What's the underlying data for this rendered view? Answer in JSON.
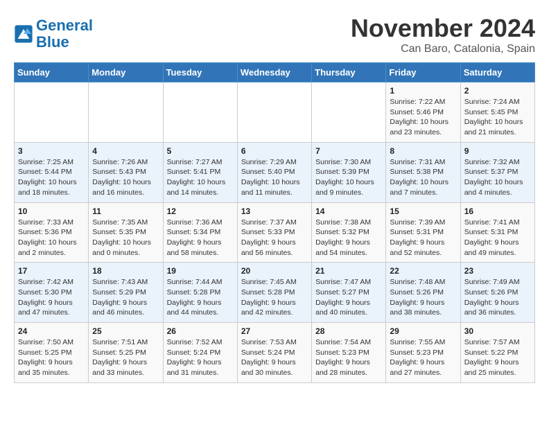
{
  "logo": {
    "line1": "General",
    "line2": "Blue"
  },
  "title": "November 2024",
  "location": "Can Baro, Catalonia, Spain",
  "weekdays": [
    "Sunday",
    "Monday",
    "Tuesday",
    "Wednesday",
    "Thursday",
    "Friday",
    "Saturday"
  ],
  "weeks": [
    [
      {
        "day": "",
        "info": ""
      },
      {
        "day": "",
        "info": ""
      },
      {
        "day": "",
        "info": ""
      },
      {
        "day": "",
        "info": ""
      },
      {
        "day": "",
        "info": ""
      },
      {
        "day": "1",
        "info": "Sunrise: 7:22 AM\nSunset: 5:46 PM\nDaylight: 10 hours and 23 minutes."
      },
      {
        "day": "2",
        "info": "Sunrise: 7:24 AM\nSunset: 5:45 PM\nDaylight: 10 hours and 21 minutes."
      }
    ],
    [
      {
        "day": "3",
        "info": "Sunrise: 7:25 AM\nSunset: 5:44 PM\nDaylight: 10 hours and 18 minutes."
      },
      {
        "day": "4",
        "info": "Sunrise: 7:26 AM\nSunset: 5:43 PM\nDaylight: 10 hours and 16 minutes."
      },
      {
        "day": "5",
        "info": "Sunrise: 7:27 AM\nSunset: 5:41 PM\nDaylight: 10 hours and 14 minutes."
      },
      {
        "day": "6",
        "info": "Sunrise: 7:29 AM\nSunset: 5:40 PM\nDaylight: 10 hours and 11 minutes."
      },
      {
        "day": "7",
        "info": "Sunrise: 7:30 AM\nSunset: 5:39 PM\nDaylight: 10 hours and 9 minutes."
      },
      {
        "day": "8",
        "info": "Sunrise: 7:31 AM\nSunset: 5:38 PM\nDaylight: 10 hours and 7 minutes."
      },
      {
        "day": "9",
        "info": "Sunrise: 7:32 AM\nSunset: 5:37 PM\nDaylight: 10 hours and 4 minutes."
      }
    ],
    [
      {
        "day": "10",
        "info": "Sunrise: 7:33 AM\nSunset: 5:36 PM\nDaylight: 10 hours and 2 minutes."
      },
      {
        "day": "11",
        "info": "Sunrise: 7:35 AM\nSunset: 5:35 PM\nDaylight: 10 hours and 0 minutes."
      },
      {
        "day": "12",
        "info": "Sunrise: 7:36 AM\nSunset: 5:34 PM\nDaylight: 9 hours and 58 minutes."
      },
      {
        "day": "13",
        "info": "Sunrise: 7:37 AM\nSunset: 5:33 PM\nDaylight: 9 hours and 56 minutes."
      },
      {
        "day": "14",
        "info": "Sunrise: 7:38 AM\nSunset: 5:32 PM\nDaylight: 9 hours and 54 minutes."
      },
      {
        "day": "15",
        "info": "Sunrise: 7:39 AM\nSunset: 5:31 PM\nDaylight: 9 hours and 52 minutes."
      },
      {
        "day": "16",
        "info": "Sunrise: 7:41 AM\nSunset: 5:31 PM\nDaylight: 9 hours and 49 minutes."
      }
    ],
    [
      {
        "day": "17",
        "info": "Sunrise: 7:42 AM\nSunset: 5:30 PM\nDaylight: 9 hours and 47 minutes."
      },
      {
        "day": "18",
        "info": "Sunrise: 7:43 AM\nSunset: 5:29 PM\nDaylight: 9 hours and 46 minutes."
      },
      {
        "day": "19",
        "info": "Sunrise: 7:44 AM\nSunset: 5:28 PM\nDaylight: 9 hours and 44 minutes."
      },
      {
        "day": "20",
        "info": "Sunrise: 7:45 AM\nSunset: 5:28 PM\nDaylight: 9 hours and 42 minutes."
      },
      {
        "day": "21",
        "info": "Sunrise: 7:47 AM\nSunset: 5:27 PM\nDaylight: 9 hours and 40 minutes."
      },
      {
        "day": "22",
        "info": "Sunrise: 7:48 AM\nSunset: 5:26 PM\nDaylight: 9 hours and 38 minutes."
      },
      {
        "day": "23",
        "info": "Sunrise: 7:49 AM\nSunset: 5:26 PM\nDaylight: 9 hours and 36 minutes."
      }
    ],
    [
      {
        "day": "24",
        "info": "Sunrise: 7:50 AM\nSunset: 5:25 PM\nDaylight: 9 hours and 35 minutes."
      },
      {
        "day": "25",
        "info": "Sunrise: 7:51 AM\nSunset: 5:25 PM\nDaylight: 9 hours and 33 minutes."
      },
      {
        "day": "26",
        "info": "Sunrise: 7:52 AM\nSunset: 5:24 PM\nDaylight: 9 hours and 31 minutes."
      },
      {
        "day": "27",
        "info": "Sunrise: 7:53 AM\nSunset: 5:24 PM\nDaylight: 9 hours and 30 minutes."
      },
      {
        "day": "28",
        "info": "Sunrise: 7:54 AM\nSunset: 5:23 PM\nDaylight: 9 hours and 28 minutes."
      },
      {
        "day": "29",
        "info": "Sunrise: 7:55 AM\nSunset: 5:23 PM\nDaylight: 9 hours and 27 minutes."
      },
      {
        "day": "30",
        "info": "Sunrise: 7:57 AM\nSunset: 5:22 PM\nDaylight: 9 hours and 25 minutes."
      }
    ]
  ]
}
